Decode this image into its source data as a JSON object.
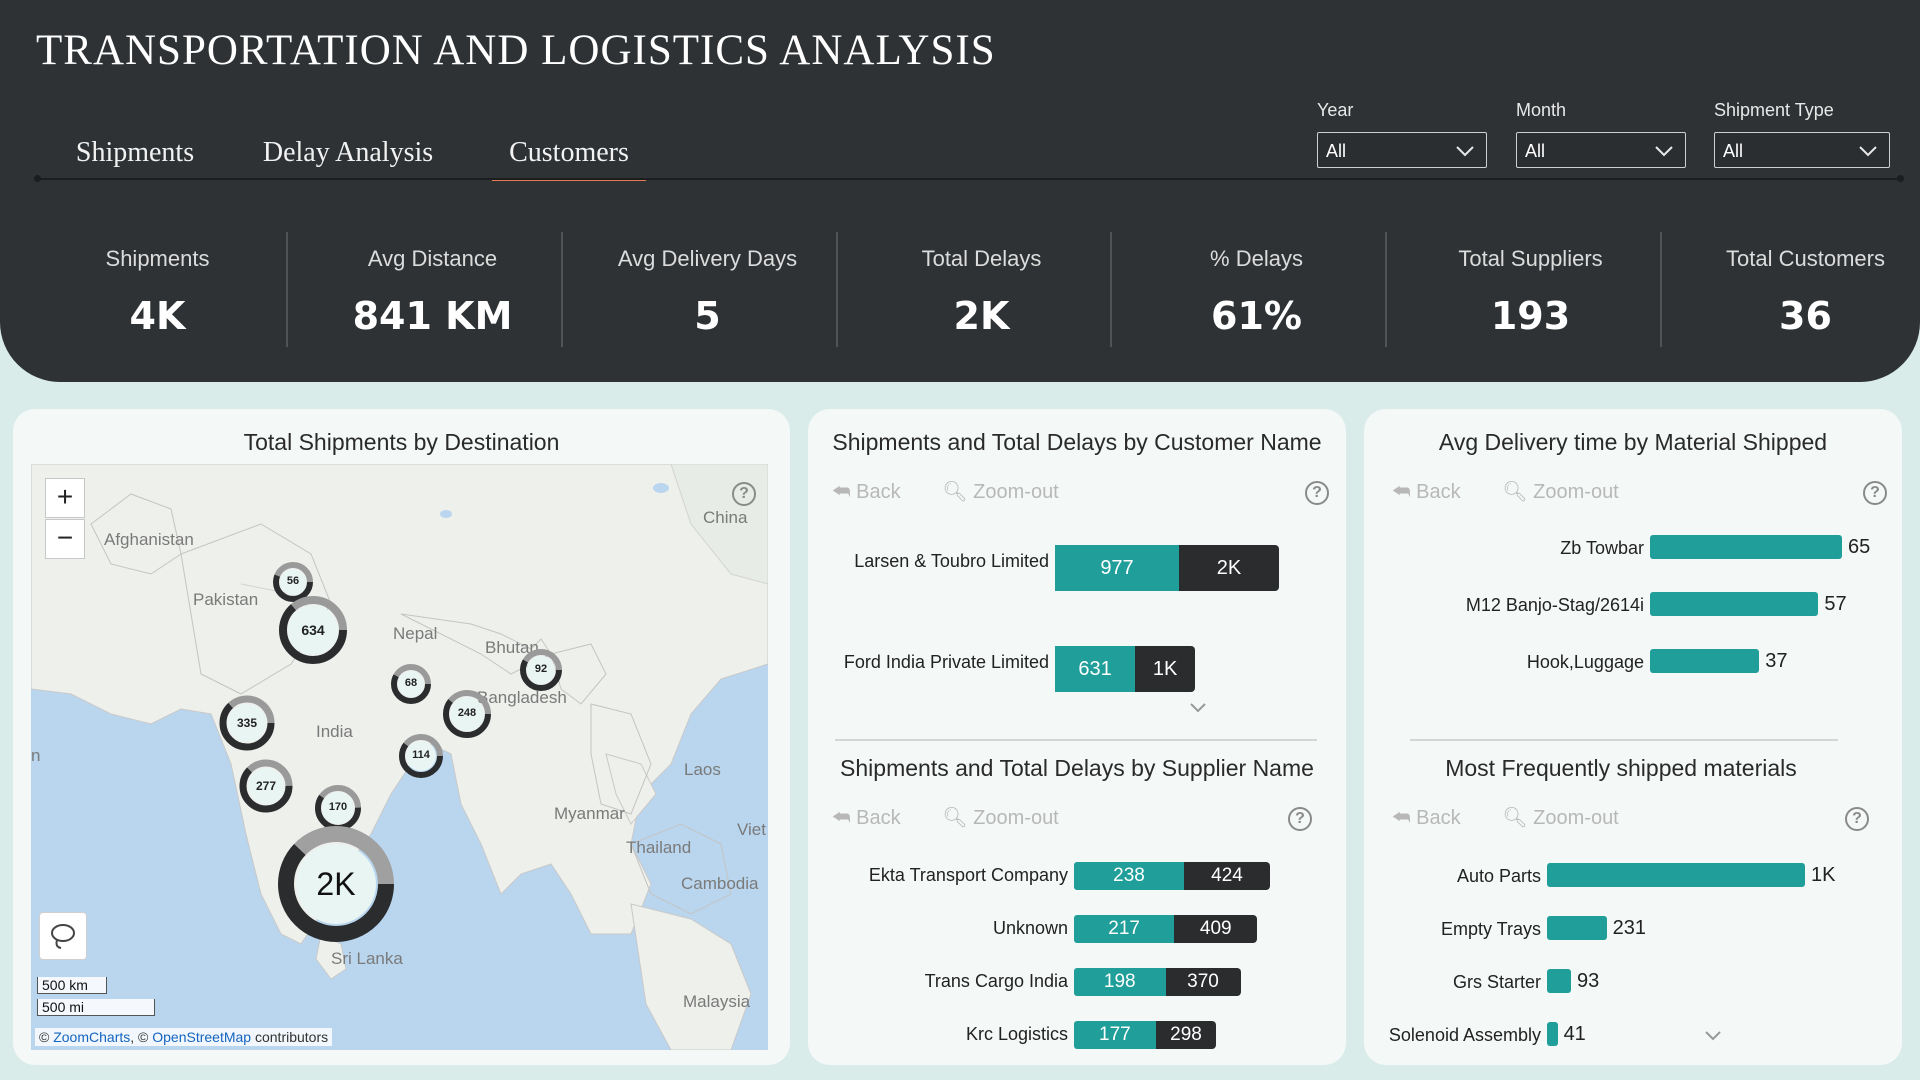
{
  "title": "TRANSPORTATION AND LOGISTICS ANALYSIS",
  "tabs": [
    {
      "label": "Shipments"
    },
    {
      "label": "Delay Analysis"
    },
    {
      "label": "Customers"
    }
  ],
  "filters": [
    {
      "label": "Year",
      "value": "All"
    },
    {
      "label": "Month",
      "value": "All"
    },
    {
      "label": "Shipment Type",
      "value": "All"
    }
  ],
  "kpis": [
    {
      "label": "Shipments",
      "value": "4K"
    },
    {
      "label": "Avg Distance",
      "value": "841 KM"
    },
    {
      "label": "Avg Delivery Days",
      "value": "5"
    },
    {
      "label": "Total Delays",
      "value": "2K"
    },
    {
      "label": "% Delays",
      "value": "61%"
    },
    {
      "label": "Total Suppliers",
      "value": "193"
    },
    {
      "label": "Total Customers",
      "value": "36"
    }
  ],
  "nav": {
    "back": "Back",
    "zoom_out": "Zoom-out",
    "help": "?"
  },
  "map": {
    "title": "Total Shipments by Destination",
    "zoom_in": "+",
    "zoom_out": "−",
    "scale_km": "500 km",
    "scale_mi": "500 mi",
    "attrib_prefix": "©",
    "attrib_zc": "ZoomCharts",
    "attrib_mid": ", ©",
    "attrib_osm": "OpenStreetMap",
    "attrib_suffix": "contributors",
    "labels": [
      "Afghanistan",
      "Pakistan",
      "Nepal",
      "Bhutan",
      "Bangladesh",
      "India",
      "China",
      "Myanmar",
      "Laos",
      "Thailand",
      "Cambodia",
      "Viet",
      "Sri Lanka",
      "Malaysia",
      "n"
    ],
    "clusters": [
      "56",
      "634",
      "68",
      "92",
      "335",
      "248",
      "114",
      "277",
      "170",
      "2K"
    ]
  },
  "customers_chart": {
    "title": "Shipments and Total Delays by Customer Name",
    "rows": [
      {
        "name": "Larsen & Toubro Limited",
        "shipments": 977,
        "shipments_label": "977",
        "delays_label": "2K",
        "delays": 2000
      },
      {
        "name": "Ford India Private Limited",
        "shipments": 631,
        "shipments_label": "631",
        "delays_label": "1K",
        "delays": 1000
      }
    ]
  },
  "suppliers_chart": {
    "title": "Shipments and Total Delays by Supplier Name",
    "rows": [
      {
        "name": "Ekta Transport Company",
        "shipments": 238,
        "shipments_label": "238",
        "delays": 424,
        "delays_label": "424"
      },
      {
        "name": "Unknown",
        "shipments": 217,
        "shipments_label": "217",
        "delays": 409,
        "delays_label": "409"
      },
      {
        "name": "Trans Cargo India",
        "shipments": 198,
        "shipments_label": "198",
        "delays": 370,
        "delays_label": "370"
      },
      {
        "name": "Krc Logistics",
        "shipments": 177,
        "shipments_label": "177",
        "delays": 298,
        "delays_label": "298"
      }
    ]
  },
  "material_chart": {
    "title": "Avg Delivery time by Material Shipped",
    "rows": [
      {
        "name": "Zb Towbar",
        "value": 65,
        "label": "65"
      },
      {
        "name": "M12 Banjo-Stag/2614i",
        "value": 57,
        "label": "57"
      },
      {
        "name": "Hook,Luggage",
        "value": 37,
        "label": "37"
      }
    ]
  },
  "frequent_chart": {
    "title": "Most Frequently shipped materials",
    "rows": [
      {
        "name": "Auto Parts",
        "value": 1000,
        "label": "1K"
      },
      {
        "name": "Empty Trays",
        "value": 231,
        "label": "231"
      },
      {
        "name": "Grs Starter",
        "value": 93,
        "label": "93"
      },
      {
        "name": "Solenoid Assembly",
        "value": 41,
        "label": "41"
      }
    ]
  },
  "colors": {
    "teal": "#1f9e9a",
    "dark": "#2a2c2e",
    "header": "#2e3234",
    "accent": "#e07a52"
  }
}
